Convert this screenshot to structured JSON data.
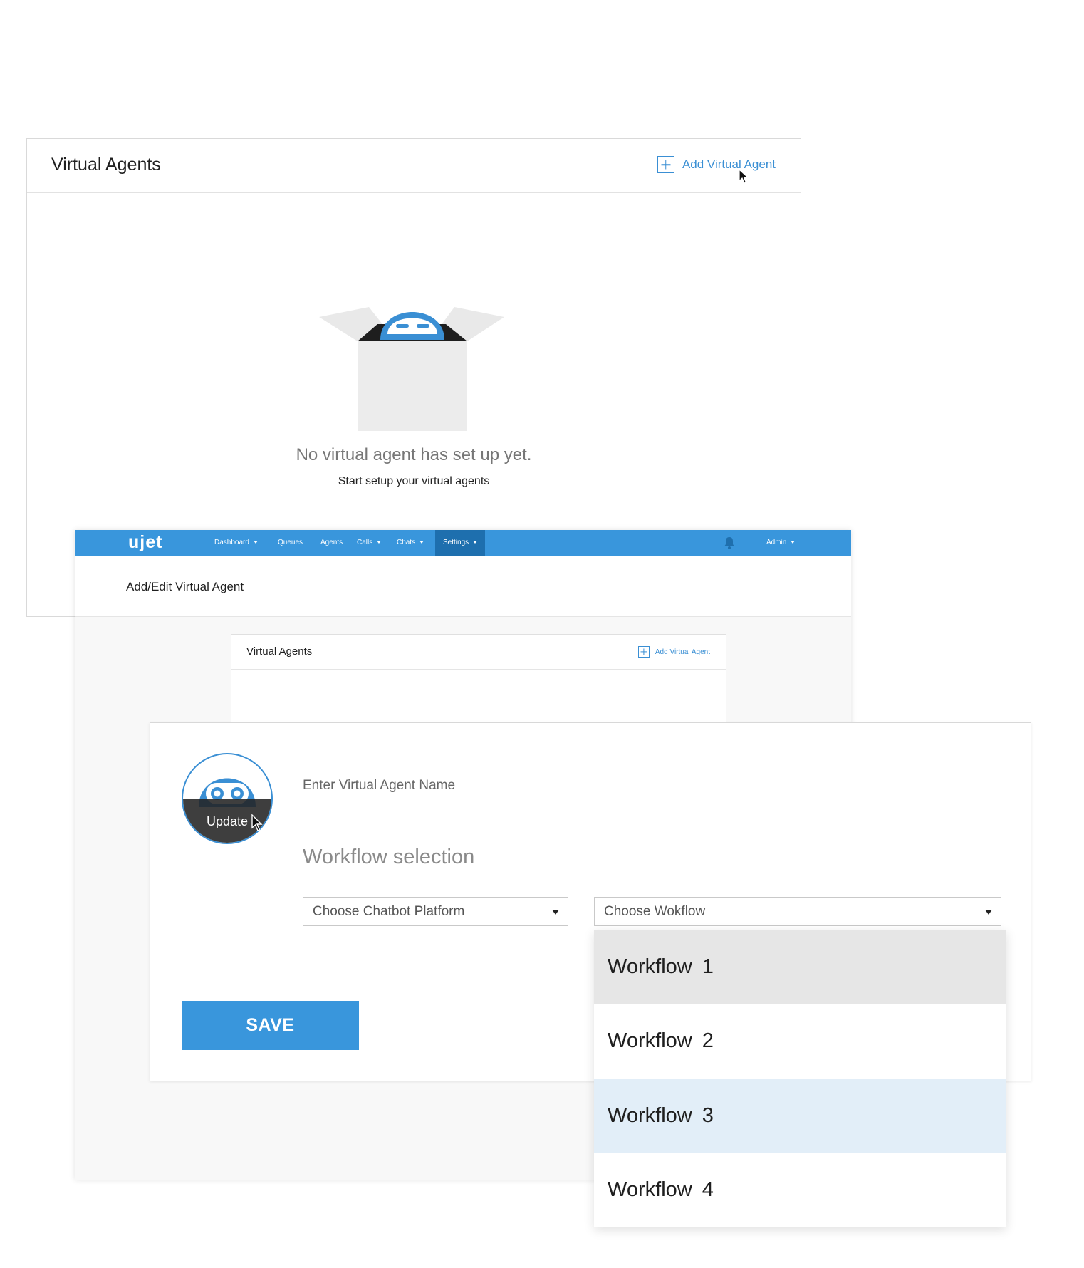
{
  "panel1": {
    "title": "Virtual Agents",
    "add_button": "Add Virtual Agent",
    "empty_title": "No virtual agent has set up yet.",
    "empty_subtitle": "Start setup your virtual agents"
  },
  "navbar": {
    "logo": "ujet",
    "items": [
      {
        "label": "Dashboard",
        "dropdown": true
      },
      {
        "label": "Queues",
        "dropdown": false
      },
      {
        "label": "Agents",
        "dropdown": false
      },
      {
        "label": "Calls",
        "dropdown": true
      },
      {
        "label": "Chats",
        "dropdown": true
      },
      {
        "label": "Settings",
        "dropdown": true,
        "active": true
      }
    ],
    "user": "Admin",
    "bell_icon": "bell-icon"
  },
  "page": {
    "title": "Add/Edit Virtual Agent"
  },
  "mini_panel": {
    "title": "Virtual Agents",
    "add_button": "Add Virtual Agent"
  },
  "form": {
    "avatar_label": "Update",
    "name_placeholder": "Enter Virtual Agent Name",
    "workflow_heading": "Workflow selection",
    "platform_select": "Choose Chatbot Platform",
    "workflow_select": "Choose Wokflow",
    "save_label": "SAVE"
  },
  "dropdown": {
    "options": [
      "Workflow 1",
      "Workflow  2",
      "Workflow  3",
      "Workflow  4"
    ],
    "hovered_index": 0,
    "selected_index": 2
  },
  "colors": {
    "accent": "#3996dc",
    "accent_dark": "#1e6fae",
    "hover_bg": "#e6e6e6",
    "selected_bg": "#e2eef8"
  }
}
